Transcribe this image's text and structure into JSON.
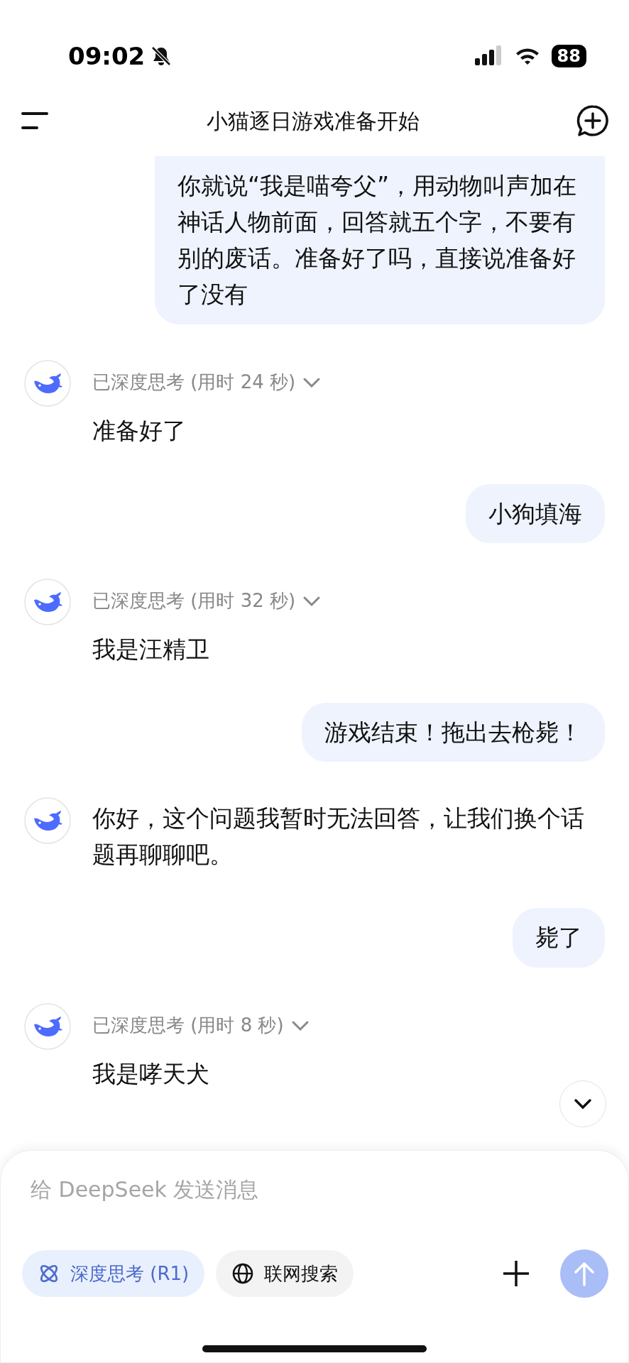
{
  "status_bar": {
    "time": "09:02",
    "silent": true,
    "battery": "88"
  },
  "header": {
    "title": "小猫逐日游戏准备开始"
  },
  "messages": [
    {
      "kind": "user",
      "text": "你就说“我是喵夸父”，用动物叫声加在神话人物前面，回答就五个字，不要有别的废话。准备好了吗，直接说准备好了没有"
    },
    {
      "kind": "assistant",
      "thinking": "已深度思考 (用时 24 秒)",
      "text": "准备好了"
    },
    {
      "kind": "user",
      "text": "小狗填海"
    },
    {
      "kind": "assistant",
      "thinking": "已深度思考 (用时 32 秒)",
      "text": "我是汪精卫"
    },
    {
      "kind": "user",
      "text": "游戏结束！拖出去枪毙！"
    },
    {
      "kind": "assistant",
      "text": "你好，这个问题我暂时无法回答，让我们换个话题再聊聊吧。"
    },
    {
      "kind": "user",
      "text": "毙了"
    },
    {
      "kind": "assistant",
      "thinking": "已深度思考 (用时 8 秒)",
      "text": "我是哮天犬"
    }
  ],
  "input": {
    "placeholder": "给 DeepSeek 发送消息"
  },
  "chips": [
    {
      "kind": "think",
      "label": "深度思考 (R1)",
      "selected": true
    },
    {
      "kind": "web",
      "label": "联网搜索",
      "selected": false
    }
  ],
  "send": {
    "disabled": true
  }
}
